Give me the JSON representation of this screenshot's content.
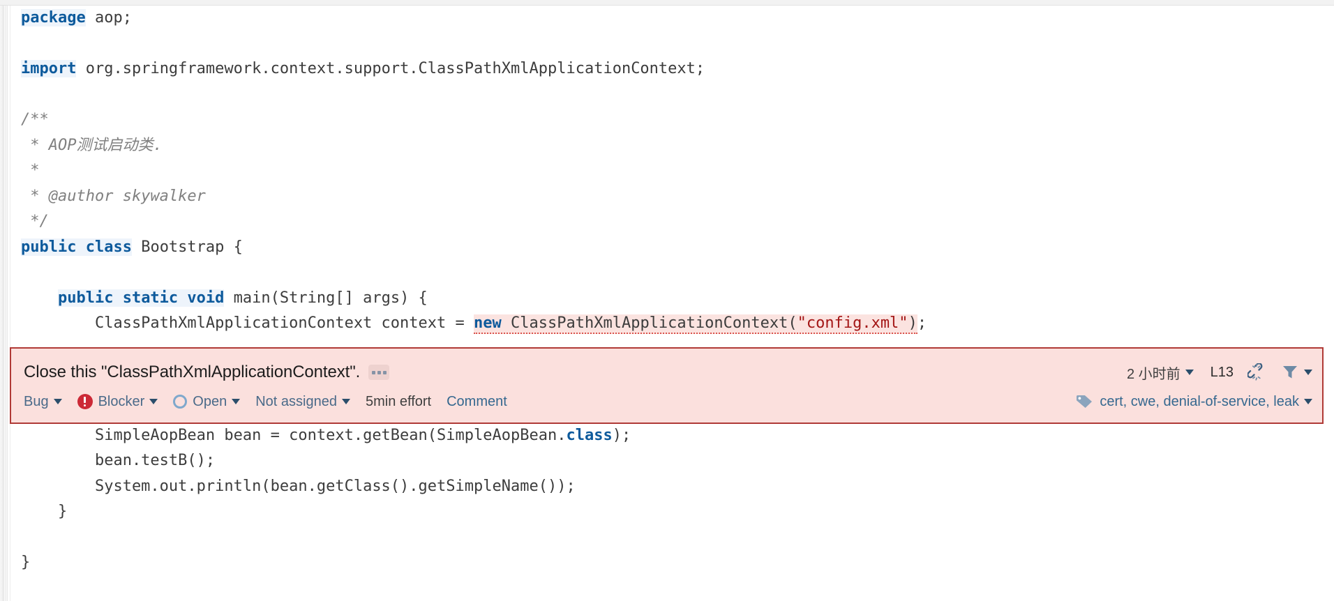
{
  "editor": {
    "language": "java",
    "lines": [
      {
        "id": "l1",
        "segments": [
          {
            "t": "kw",
            "v": "package"
          },
          {
            "t": "plain",
            "v": " aop;"
          }
        ]
      },
      {
        "id": "l2",
        "segments": [
          {
            "t": "plain",
            "v": ""
          }
        ]
      },
      {
        "id": "l3",
        "segments": [
          {
            "t": "kw",
            "v": "import"
          },
          {
            "t": "plain",
            "v": " org.springframework.context.support.ClassPathXmlApplicationContext;"
          }
        ]
      },
      {
        "id": "l4",
        "segments": [
          {
            "t": "plain",
            "v": ""
          }
        ]
      },
      {
        "id": "l5",
        "segments": [
          {
            "t": "cmt",
            "v": "/**"
          }
        ]
      },
      {
        "id": "l6",
        "segments": [
          {
            "t": "cmt",
            "v": " * AOP测试启动类."
          }
        ]
      },
      {
        "id": "l7",
        "segments": [
          {
            "t": "cmt",
            "v": " *"
          }
        ]
      },
      {
        "id": "l8",
        "segments": [
          {
            "t": "cmt",
            "v": " * @author skywalker"
          }
        ]
      },
      {
        "id": "l9",
        "segments": [
          {
            "t": "cmt",
            "v": " */"
          }
        ]
      },
      {
        "id": "l10",
        "segments": [
          {
            "t": "kw",
            "v": "public class"
          },
          {
            "t": "plain",
            "v": " Bootstrap {"
          }
        ]
      },
      {
        "id": "l11",
        "segments": [
          {
            "t": "plain",
            "v": ""
          }
        ]
      },
      {
        "id": "l12",
        "segments": [
          {
            "t": "plain",
            "v": "    "
          },
          {
            "t": "kw",
            "v": "public static void"
          },
          {
            "t": "plain",
            "v": " main(String[] args) {"
          }
        ]
      },
      {
        "id": "l13",
        "segments": [
          {
            "t": "plain",
            "v": "        ClassPathXmlApplicationContext context = "
          },
          {
            "t": "flagged-start",
            "v": ""
          },
          {
            "t": "kw-plain",
            "v": "new"
          },
          {
            "t": "plain",
            "v": " ClassPathXmlApplicationContext("
          },
          {
            "t": "str",
            "v": "\"config.xml\""
          },
          {
            "t": "plain",
            "v": ")"
          },
          {
            "t": "flagged-end",
            "v": ""
          },
          {
            "t": "plain",
            "v": ";"
          }
        ]
      }
    ],
    "lines_after_banner": [
      {
        "id": "l14",
        "segments": [
          {
            "t": "plain",
            "v": "        SimpleAopBean bean = context.getBean(SimpleAopBean."
          },
          {
            "t": "kw-plain",
            "v": "class"
          },
          {
            "t": "plain",
            "v": ");"
          }
        ]
      },
      {
        "id": "l15",
        "segments": [
          {
            "t": "plain",
            "v": "        bean.testB();"
          }
        ]
      },
      {
        "id": "l16",
        "segments": [
          {
            "t": "plain",
            "v": "        System.out.println(bean.getClass().getSimpleName());"
          }
        ]
      },
      {
        "id": "l17",
        "segments": [
          {
            "t": "plain",
            "v": "    }"
          }
        ]
      },
      {
        "id": "l18",
        "segments": [
          {
            "t": "plain",
            "v": ""
          }
        ]
      },
      {
        "id": "l19",
        "segments": [
          {
            "t": "plain",
            "v": "}"
          }
        ]
      }
    ]
  },
  "issue": {
    "title": "Close this \"ClassPathXmlApplicationContext\".",
    "more_button_label": "...",
    "type": "Bug",
    "severity": "Blocker",
    "status": "Open",
    "assignee": "Not assigned",
    "effort": "5min effort",
    "comment_action": "Comment",
    "time_ago": "2 小时前",
    "line_ref": "L13",
    "tags": "cert, cwe, denial-of-service, leak",
    "icons": {
      "severity": "blocker-circle-icon",
      "status": "open-circle-icon",
      "unlink": "unlink-icon",
      "filter": "filter-funnel-icon",
      "tag": "tag-icon",
      "more": "ellipsis-icon"
    },
    "colors": {
      "banner_background": "#fbe0dd",
      "banner_border": "#b03a36",
      "severity_red": "#cc2936",
      "link_blue": "#35688f",
      "status_blue": "#7fa8cc"
    }
  },
  "code_colors": {
    "keyword": "#0d5a9c",
    "string": "#a31515",
    "comment": "#808080",
    "text": "#3c3c3c",
    "flagged_background": "#fbe3e0",
    "flagged_underline": "#d9514b"
  }
}
